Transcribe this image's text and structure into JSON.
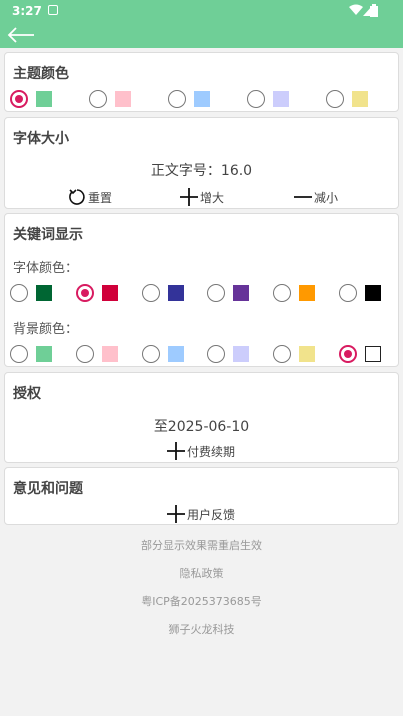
{
  "status": {
    "time": "3:27"
  },
  "theme": {
    "title": "主题颜色",
    "options": [
      {
        "color": "#6fcf97",
        "selected": true
      },
      {
        "color": "#ffc0cb",
        "selected": false
      },
      {
        "color": "#9ecbff",
        "selected": false
      },
      {
        "color": "#cccdfc",
        "selected": false
      },
      {
        "color": "#f1e38c",
        "selected": false
      }
    ]
  },
  "font_size": {
    "title": "字体大小",
    "current": "正文字号：16.0",
    "reset_label": "重置",
    "increase_label": "增大",
    "decrease_label": "减小"
  },
  "keyword": {
    "title": "关键词显示",
    "font_color_label": "字体颜色：",
    "font_colors": [
      {
        "color": "#006633",
        "selected": false
      },
      {
        "color": "#d0003a",
        "selected": true
      },
      {
        "color": "#333399",
        "selected": false
      },
      {
        "color": "#663399",
        "selected": false
      },
      {
        "color": "#ff9900",
        "selected": false
      },
      {
        "color": "#000000",
        "selected": false
      }
    ],
    "bg_color_label": "背景颜色：",
    "bg_colors": [
      {
        "color": "#6fcf97",
        "selected": false
      },
      {
        "color": "#ffc0cb",
        "selected": false
      },
      {
        "color": "#9ecbff",
        "selected": false
      },
      {
        "color": "#cccdfc",
        "selected": false
      },
      {
        "color": "#f1e38c",
        "selected": false
      },
      {
        "color": "#ffffff",
        "selected": true
      }
    ]
  },
  "license": {
    "title": "授权",
    "expiry": "至2025-06-10",
    "renew_label": "付费续期"
  },
  "feedback": {
    "title": "意见和问题",
    "button_label": "用户反馈"
  },
  "footer": {
    "restart_note": "部分显示效果需重启生效",
    "privacy": "隐私政策",
    "icp": "粤ICP备2025373685号",
    "company": "狮子火龙科技"
  }
}
